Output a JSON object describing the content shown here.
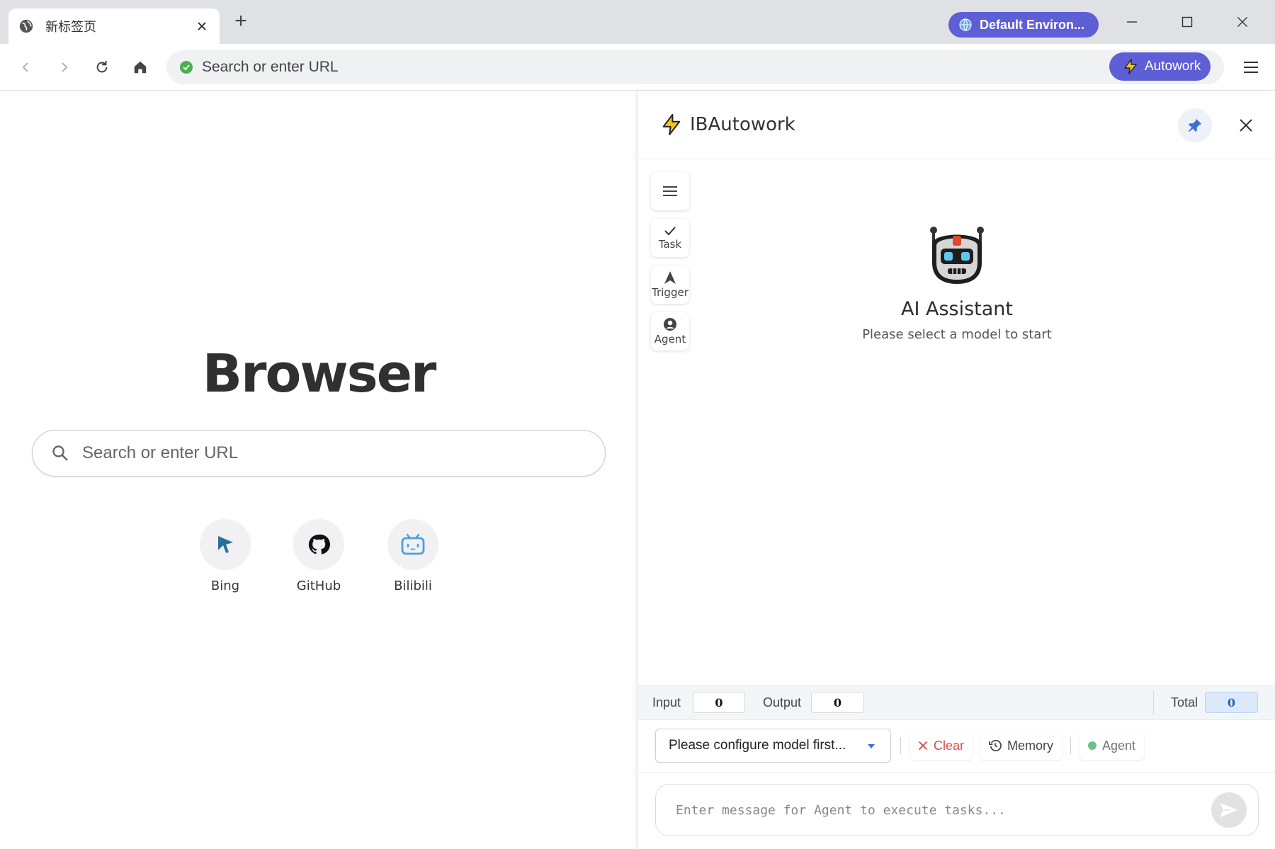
{
  "tab": {
    "title": "新标签页",
    "icon": "globe-icon",
    "close_icon": "close-icon"
  },
  "tabstrip": {
    "new_tab_symbol": "+"
  },
  "environment": {
    "label": "Default Environ...",
    "icon": "globe-icon",
    "color": "#5e5ed6"
  },
  "window_controls": [
    "minimize-icon",
    "maximize-icon",
    "close-icon"
  ],
  "toolbar": {
    "address_placeholder": "Search or enter URL",
    "autowork_label": "Autowork",
    "accent": "#5e5ed6"
  },
  "newtab": {
    "brand": "Browser",
    "search_placeholder": "Search or enter URL",
    "shortcuts": [
      {
        "label": "Bing",
        "icon": "cursor-arrow-icon"
      },
      {
        "label": "GitHub",
        "icon": "github-icon"
      },
      {
        "label": "Bilibili",
        "icon": "bilibili-icon"
      }
    ]
  },
  "panel": {
    "title": "IBAutowork",
    "rail": [
      {
        "label": "",
        "icon": "hamburger-menu-icon"
      },
      {
        "label": "Task",
        "icon": "check-icon"
      },
      {
        "label": "Trigger",
        "icon": "navigation-arrow-icon"
      },
      {
        "label": "Agent",
        "icon": "user-circle-icon"
      }
    ],
    "assistant_title": "AI Assistant",
    "assistant_subtitle": "Please select a model to start",
    "tokens": {
      "input_label": "Input",
      "input_value": "0",
      "output_label": "Output",
      "output_value": "0",
      "total_label": "Total",
      "total_value": "0"
    },
    "model_select": "Please configure model first...",
    "actions": {
      "clear": "Clear",
      "memory": "Memory",
      "agent": "Agent"
    },
    "message_placeholder": "Enter message for Agent to execute tasks...",
    "colors": {
      "clear": "#d94a4a",
      "agent_dot": "#6fbf8b",
      "total_bg": "#dbe9fb"
    }
  }
}
